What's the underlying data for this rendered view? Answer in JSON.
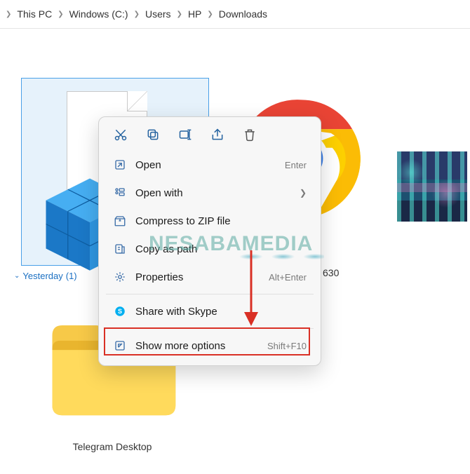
{
  "breadcrumb": {
    "items": [
      "This PC",
      "Windows (C:)",
      "Users",
      "HP",
      "Downloads"
    ]
  },
  "group": {
    "label": "Yesterday",
    "count": "(1)"
  },
  "tiles": {
    "chrome_version": "630",
    "folder_label": "Telegram Desktop"
  },
  "context_menu": {
    "open": {
      "label": "Open",
      "hint": "Enter"
    },
    "open_with": {
      "label": "Open with"
    },
    "compress": {
      "label": "Compress to ZIP file"
    },
    "copy_path": {
      "label": "Copy as path"
    },
    "properties": {
      "label": "Properties",
      "hint": "Alt+Enter"
    },
    "share_skype": {
      "label": "Share with Skype"
    },
    "show_more": {
      "label": "Show more options",
      "hint": "Shift+F10"
    }
  },
  "watermark": "NESABAMEDIA"
}
